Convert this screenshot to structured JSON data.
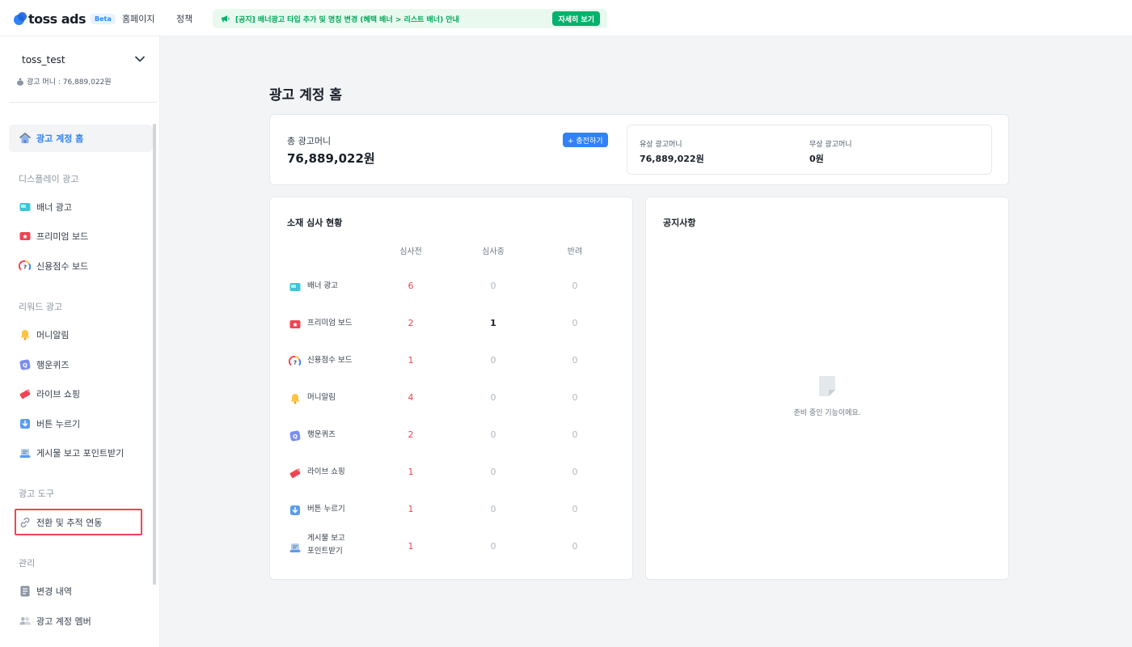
{
  "header": {
    "logo_text": "toss ads",
    "beta": "Beta",
    "nav": [
      "홈페이지",
      "정책"
    ],
    "notice_text": "[공지] 배너광고 타입 추가 및 명칭 변경 (혜택 배너 > 리스트 배너) 안내",
    "notice_button": "자세히 보기"
  },
  "sidebar": {
    "account_name": "toss_test",
    "money_label": "광고 머니 : 76,889,022원",
    "home": "광고 계정 홈",
    "section_display": "디스플레이 광고",
    "display_items": [
      "배너 광고",
      "프리미엄 보드",
      "신용점수 보드"
    ],
    "section_reward": "리워드 광고",
    "reward_items": [
      "머니알림",
      "행운퀴즈",
      "라이브 쇼핑",
      "버튼 누르기",
      "게시물 보고 포인트받기"
    ],
    "section_tools": "광고 도구",
    "tool_items": [
      "전환 및 추적 연동"
    ],
    "section_manage": "관리",
    "manage_items": [
      "변경 내역",
      "광고 계정 멤버"
    ]
  },
  "main": {
    "title": "광고 계정 홈",
    "total_label": "총 광고머니",
    "total_value": "76,889,022원",
    "charge_button": "+ 충전하기",
    "paid_label": "유상 광고머니",
    "paid_value": "76,889,022원",
    "free_label": "무상 광고머니",
    "free_value": "0원"
  },
  "review": {
    "title": "소재 심사 현황",
    "columns": [
      "심사전",
      "심사중",
      "반려"
    ],
    "rows": [
      {
        "name": "배너 광고",
        "v": [
          "6",
          "0",
          "0"
        ]
      },
      {
        "name": "프리미엄 보드",
        "v": [
          "2",
          "1",
          "0"
        ]
      },
      {
        "name": "신용점수 보드",
        "v": [
          "1",
          "0",
          "0"
        ]
      },
      {
        "name": "머니알림",
        "v": [
          "4",
          "0",
          "0"
        ]
      },
      {
        "name": "행운퀴즈",
        "v": [
          "2",
          "0",
          "0"
        ]
      },
      {
        "name": "라이브 쇼핑",
        "v": [
          "1",
          "0",
          "0"
        ]
      },
      {
        "name": "버튼 누르기",
        "v": [
          "1",
          "0",
          "0"
        ]
      },
      {
        "name": "게시물 보고",
        "name2": "포인트받기",
        "v": [
          "1",
          "0",
          "0"
        ]
      }
    ]
  },
  "notice": {
    "title": "공지사항",
    "empty_text": "준비 중인 기능이에요."
  },
  "colors": {
    "accent": "#3182f6",
    "danger": "#f04452",
    "success": "#03b26c"
  }
}
